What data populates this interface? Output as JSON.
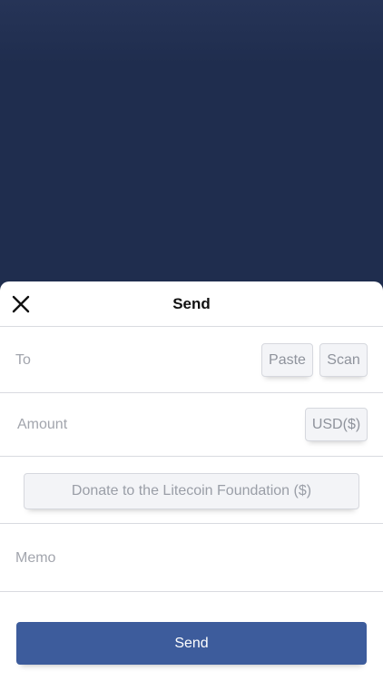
{
  "header": {
    "title": "Send",
    "close_icon": "close-icon"
  },
  "to": {
    "placeholder": "To",
    "paste_label": "Paste",
    "scan_label": "Scan"
  },
  "amount": {
    "placeholder": "Amount",
    "currency_label": "USD($)"
  },
  "donate": {
    "label": "Donate to the Litecoin Foundation ($)"
  },
  "memo": {
    "placeholder": "Memo"
  },
  "footer": {
    "send_label": "Send"
  },
  "colors": {
    "backdrop": "#1f2d4e",
    "sheet": "#ffffff",
    "send_button": "#3d5c9c",
    "chip_bg": "#f3f4f7",
    "placeholder_text": "#a2a5ad"
  }
}
